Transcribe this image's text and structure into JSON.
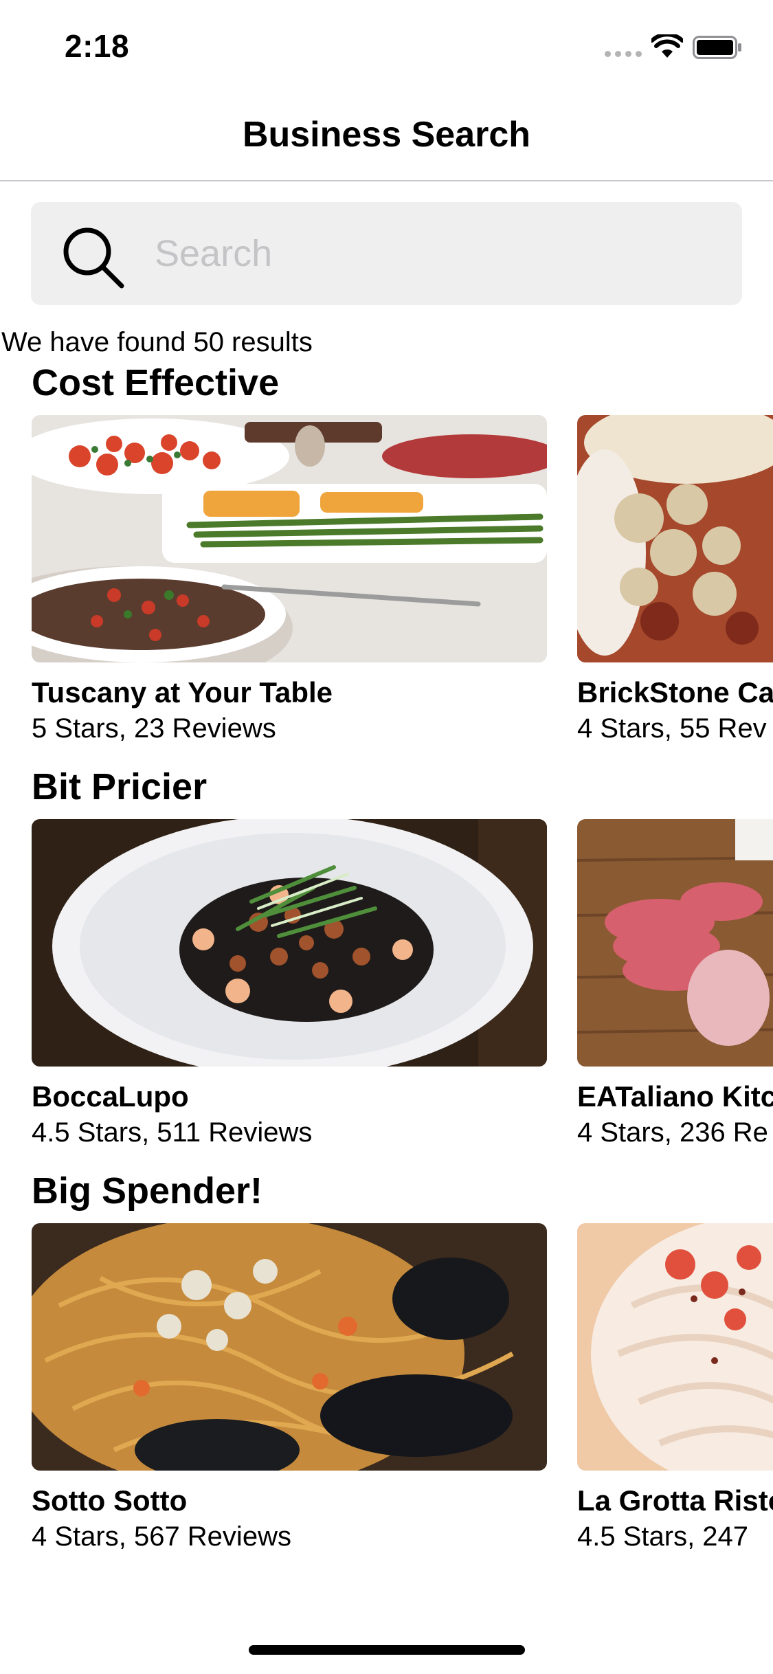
{
  "status_bar": {
    "time": "2:18",
    "icons": [
      "signal-dots-icon",
      "wifi-icon",
      "battery-icon"
    ]
  },
  "nav": {
    "title": "Business Search"
  },
  "search": {
    "placeholder": "Search",
    "value": "",
    "icon": "search-icon"
  },
  "results_text": "We have found 50 results",
  "sections": [
    {
      "title": "Cost Effective",
      "cards": [
        {
          "name": "Tuscany at Your Table",
          "meta": "5 Stars, 23 Reviews"
        },
        {
          "name": "BrickStone Ca",
          "meta": "4 Stars, 55 Rev"
        }
      ]
    },
    {
      "title": "Bit Pricier",
      "cards": [
        {
          "name": "BoccaLupo",
          "meta": "4.5 Stars, 511 Reviews"
        },
        {
          "name": "EATaliano Kitc",
          "meta": "4 Stars, 236 Re"
        }
      ]
    },
    {
      "title": "Big Spender!",
      "cards": [
        {
          "name": "Sotto Sotto",
          "meta": "4 Stars, 567 Reviews"
        },
        {
          "name": "La Grotta Risto",
          "meta": "4.5 Stars, 247"
        }
      ]
    }
  ],
  "colors": {
    "search_background": "#efeff0",
    "placeholder": "#c4c4c7",
    "divider": "#c8c8cc"
  }
}
